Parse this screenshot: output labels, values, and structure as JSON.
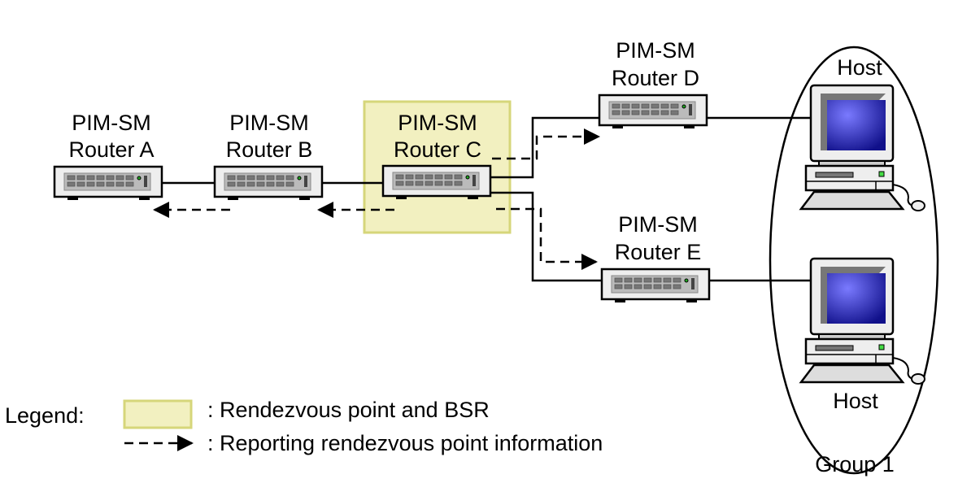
{
  "routers": [
    {
      "id": "a",
      "line1": "PIM-SM",
      "line2": "Router A"
    },
    {
      "id": "b",
      "line1": "PIM-SM",
      "line2": "Router B"
    },
    {
      "id": "c",
      "line1": "PIM-SM",
      "line2": "Router C"
    },
    {
      "id": "d",
      "line1": "PIM-SM",
      "line2": "Router D"
    },
    {
      "id": "e",
      "line1": "PIM-SM",
      "line2": "Router E"
    }
  ],
  "hosts": [
    {
      "label": "Host"
    },
    {
      "label": "Host"
    }
  ],
  "group": {
    "label": "Group 1"
  },
  "legend": {
    "title": "Legend:",
    "rp_label": ": Rendezvous point and BSR",
    "arrow_label": ": Reporting rendezvous point information"
  },
  "colors": {
    "rp_fill": "#f2f0c0",
    "rp_stroke": "#d6d67a",
    "screen": "#2a2ab0"
  }
}
